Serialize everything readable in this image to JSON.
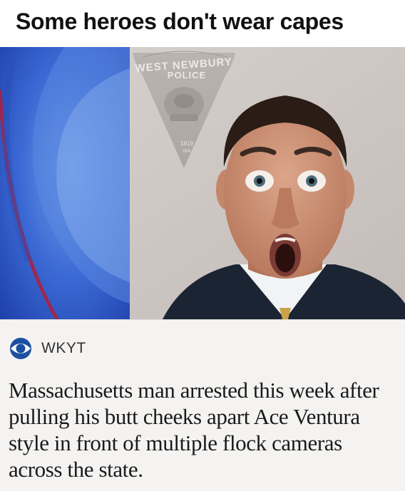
{
  "meme": {
    "caption": "Some heroes don't wear capes"
  },
  "photo": {
    "badge_arc_text": "WEST NEWBURY",
    "badge_title": "POLICE",
    "badge_year": "1819",
    "badge_state": "MA"
  },
  "news": {
    "source": "WKYT",
    "source_icon": "cbs-eye-icon",
    "headline": "Massachusetts man arrested this week after pulling his butt cheeks apart Ace Ventura style in front of multiple flock cameras across the state."
  }
}
